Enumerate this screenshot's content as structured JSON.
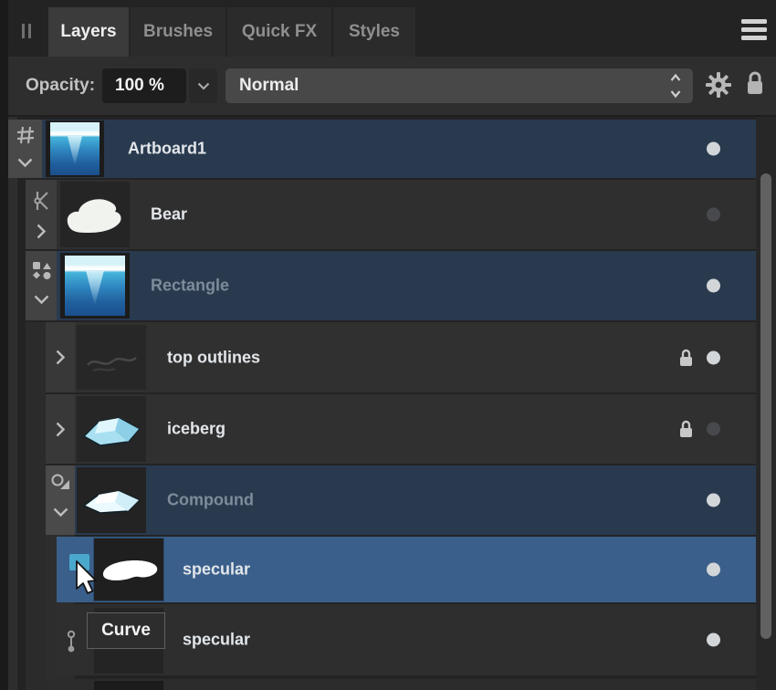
{
  "header": {
    "tabs": [
      {
        "label": "Layers",
        "active": true
      },
      {
        "label": "Brushes",
        "active": false
      },
      {
        "label": "Quick FX",
        "active": false
      },
      {
        "label": "Styles",
        "active": false
      }
    ],
    "menu_icon": "hamburger-icon",
    "handle_icon": "drag-handle-icon"
  },
  "controls": {
    "opacity_label": "Opacity:",
    "opacity_value": "100 %",
    "blend_mode": "Normal",
    "gear_icon": "gear-icon",
    "lock_icon": "lock-icon"
  },
  "layers": [
    {
      "name": "Artboard1",
      "type": "artboard",
      "expanded": true,
      "visible": true,
      "locked": false,
      "selection": "parent"
    },
    {
      "name": "Bear",
      "type": "curves",
      "expanded": false,
      "visible": false,
      "locked": false,
      "selection": "none"
    },
    {
      "name": "Rectangle",
      "type": "shapes",
      "expanded": true,
      "visible": true,
      "locked": false,
      "selection": "parent"
    },
    {
      "name": "top outlines",
      "type": "group",
      "expanded": false,
      "visible": true,
      "locked": true,
      "selection": "none"
    },
    {
      "name": "iceberg",
      "type": "group",
      "expanded": false,
      "visible": false,
      "locked": true,
      "selection": "none"
    },
    {
      "name": "Compound",
      "type": "compound",
      "expanded": true,
      "visible": true,
      "locked": false,
      "selection": "parent"
    },
    {
      "name": "specular",
      "type": "curve",
      "expanded": null,
      "visible": true,
      "locked": false,
      "selection": "active"
    },
    {
      "name": "specular",
      "type": "curve",
      "expanded": null,
      "visible": true,
      "locked": false,
      "selection": "none"
    }
  ],
  "tooltip": {
    "label": "Curve"
  },
  "colors": {
    "selection_active": "#3a5f8a",
    "selection_parent": "#293a4f",
    "row_dark": "#2f2f2f",
    "accent_square": "#4aa8cd"
  }
}
